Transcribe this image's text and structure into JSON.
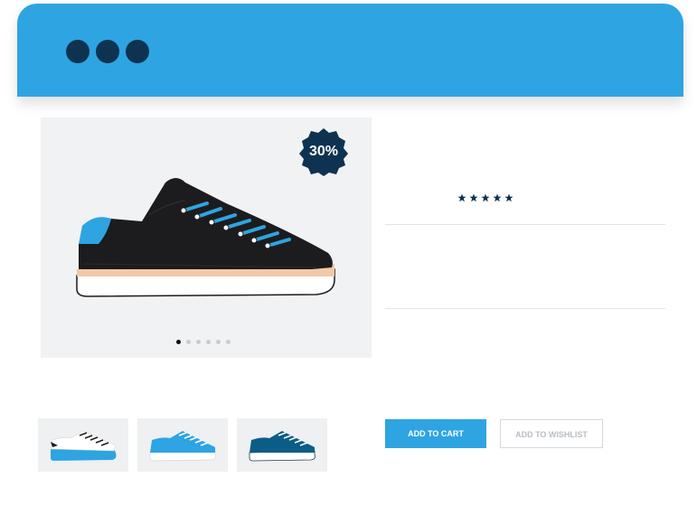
{
  "window": {
    "controls": [
      "dot-1",
      "dot-2",
      "dot-3"
    ],
    "header_color": "#2ea4e2",
    "control_color": "#0e3350"
  },
  "product": {
    "discount_badge": "30%",
    "image_icon": "black-sneaker-with-blue-laces",
    "carousel": {
      "count": 6,
      "active_index": 0
    },
    "rating": {
      "stars": 5,
      "max": 5
    }
  },
  "thumbnails": [
    {
      "icon": "white-blue-sneaker"
    },
    {
      "icon": "light-blue-sneaker"
    },
    {
      "icon": "dark-teal-sneaker"
    }
  ],
  "actions": {
    "add_to_cart": "ADD TO CART",
    "add_to_wishlist": "ADD TO WISHLIST"
  },
  "colors": {
    "accent": "#2ea4e2",
    "dark": "#0e3350",
    "image_bg": "#f1f2f4"
  }
}
